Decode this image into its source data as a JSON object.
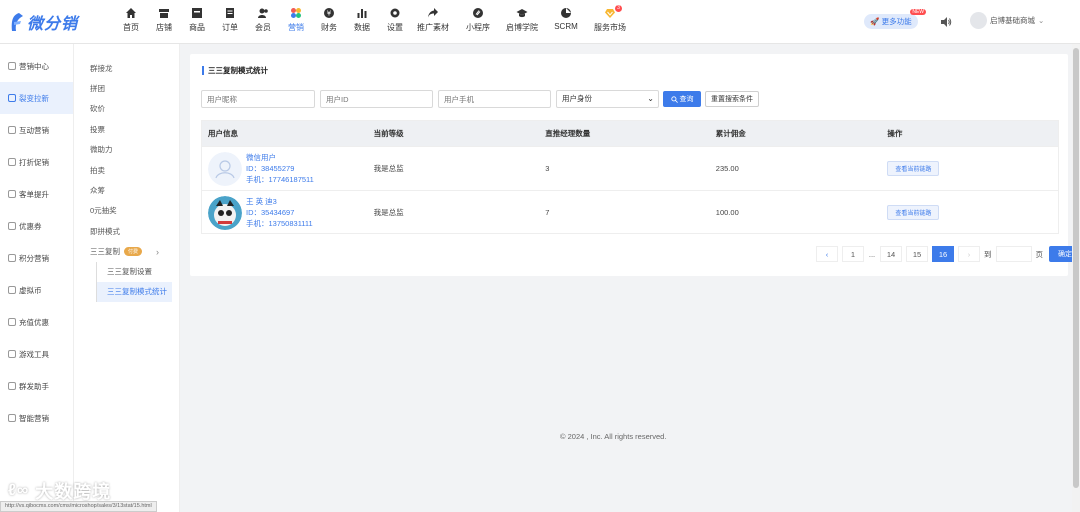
{
  "brand": {
    "name": "微分销"
  },
  "top_nav": [
    {
      "label": "首页",
      "icon": "home-icon"
    },
    {
      "label": "店铺",
      "icon": "store-icon"
    },
    {
      "label": "商品",
      "icon": "goods-icon"
    },
    {
      "label": "订单",
      "icon": "order-icon"
    },
    {
      "label": "会员",
      "icon": "member-icon"
    },
    {
      "label": "营销",
      "icon": "marketing-icon"
    },
    {
      "label": "财务",
      "icon": "finance-icon"
    },
    {
      "label": "数据",
      "icon": "data-icon"
    },
    {
      "label": "设置",
      "icon": "settings-icon"
    },
    {
      "label": "推广素材",
      "icon": "share-icon"
    },
    {
      "label": "小程序",
      "icon": "miniapp-icon"
    },
    {
      "label": "启博学院",
      "icon": "academy-icon"
    },
    {
      "label": "SCRM",
      "icon": "scrm-icon"
    },
    {
      "label": "服务市场",
      "icon": "market-icon",
      "badge": "3"
    }
  ],
  "header_right": {
    "more": "更多功能",
    "more_badge": "NEW",
    "user": "启博基础商城"
  },
  "sidebar": [
    {
      "label": "营销中心"
    },
    {
      "label": "裂变拉新"
    },
    {
      "label": "互动营销"
    },
    {
      "label": "打折促销"
    },
    {
      "label": "客单提升"
    },
    {
      "label": "优惠券"
    },
    {
      "label": "积分营销"
    },
    {
      "label": "虚拟币"
    },
    {
      "label": "充值优惠"
    },
    {
      "label": "游戏工具"
    },
    {
      "label": "群发助手"
    },
    {
      "label": "智能营销"
    }
  ],
  "subnav": [
    {
      "label": "群接龙"
    },
    {
      "label": "拼团"
    },
    {
      "label": "砍价"
    },
    {
      "label": "投票"
    },
    {
      "label": "微助力"
    },
    {
      "label": "拍卖"
    },
    {
      "label": "众筹"
    },
    {
      "label": "0元抽奖"
    },
    {
      "label": "即拼模式"
    },
    {
      "label": "三三复制",
      "tag": "付费"
    }
  ],
  "subnav_children": [
    {
      "label": "三三复制设置"
    },
    {
      "label": "三三复制模式统计"
    }
  ],
  "page": {
    "title": "三三复制模式统计",
    "filters": {
      "nickname": "用户昵称",
      "user_id": "用户ID",
      "phone": "用户手机",
      "identity": "用户身份"
    },
    "search_label": "查询",
    "reset_label": "重置搜索条件"
  },
  "table": {
    "headers": [
      "用户信息",
      "当前等级",
      "直推经理数量",
      "累计佣金",
      "操作"
    ],
    "rows": [
      {
        "name": "微信用户",
        "id": "ID：38455279",
        "phone": "手机：17746187511",
        "level": "我是总监",
        "count": "3",
        "commission": "235.00",
        "action": "查看当前链路"
      },
      {
        "name": "王 英 迪3",
        "id": "ID：35434697",
        "phone": "手机：13750831111",
        "level": "我是总监",
        "count": "7",
        "commission": "100.00",
        "action": "查看当前链路"
      }
    ]
  },
  "pagination": {
    "pages": [
      "1",
      "...",
      "14",
      "15",
      "16"
    ],
    "current": "16",
    "goto_prefix": "到",
    "goto_suffix": "页",
    "confirm": "确定"
  },
  "footer": "© 2024 , Inc. All rights reserved.",
  "watermark": "大数跨境",
  "status_url": "http://vs.qibocms.com/cms/microshop/sales/3/13stat/15.html",
  "colors": {
    "accent": "#3d7bea",
    "paid_tag": "#e8a84a",
    "badge": "#ff4d4f"
  }
}
